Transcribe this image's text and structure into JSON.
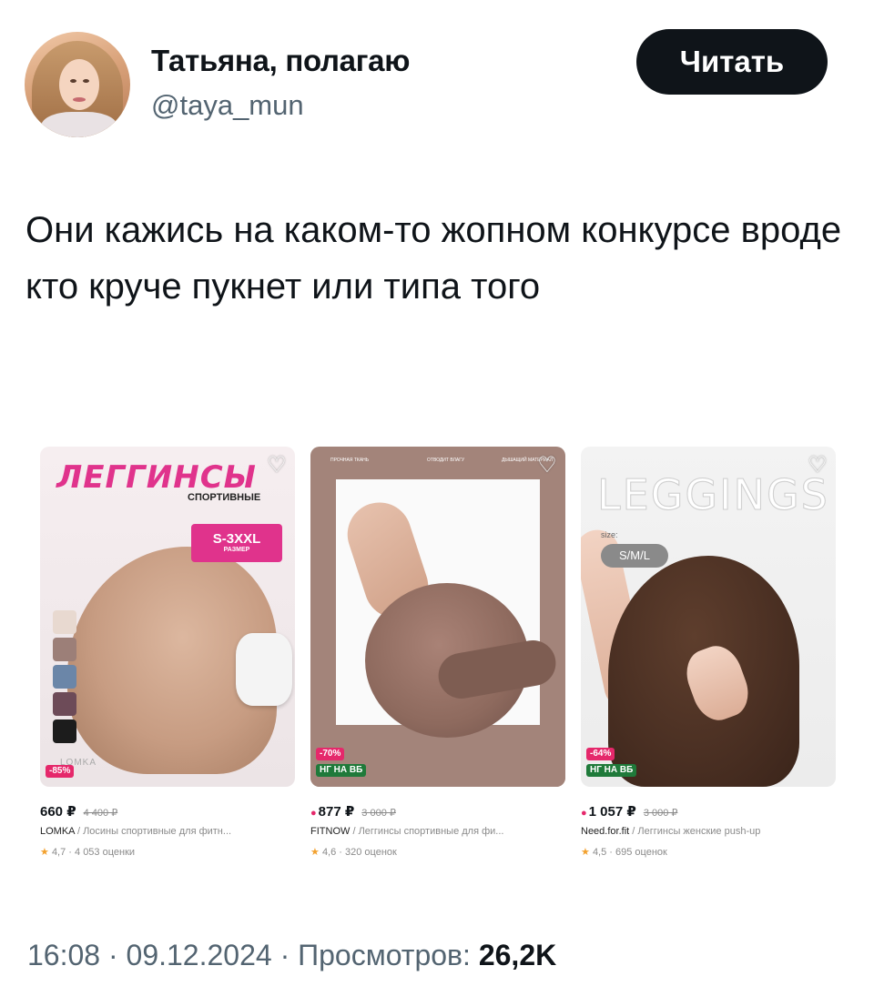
{
  "author": {
    "name": "Татьяна, полагаю",
    "handle": "@taya_mun",
    "avatar_icon": "profile-photo"
  },
  "follow_button_label": "Читать",
  "tweet_text": "Они кажись на каком-то жопном конкурсе вроде кто круче пукнет или типа того",
  "products": [
    {
      "image": {
        "title": "ЛЕГГИНСЫ",
        "subtitle": "СПОРТИВНЫЕ",
        "size": "S-3XXL",
        "size_caption": "РАЗМЕР",
        "logo": "LOMKA",
        "swatches": [
          "#e8d9d0",
          "#9c7f78",
          "#6b86a8",
          "#6d4b58",
          "#1c1c1c"
        ],
        "badge_sale": "-85%"
      },
      "price": "660 ₽",
      "old_price": "4 400 ₽",
      "brand": "LOMKA",
      "description": "Лосины спортивные для фитн...",
      "rating": "4,7",
      "reviews": "4 053 оценки"
    },
    {
      "image": {
        "top_labels": [
          "ПРОЧНАЯ ТКАНЬ",
          "ОТВОДИТ ВЛАГУ",
          "ДЫШАЩИЙ МАТЕРИАЛ"
        ],
        "badge_sale": "-70%",
        "badge_ng": "НГ НА ВБ"
      },
      "price": "877 ₽",
      "old_price": "3 000 ₽",
      "brand": "FITNOW",
      "description": "Леггинсы спортивные для фи...",
      "rating": "4,6",
      "reviews": "320 оценок"
    },
    {
      "image": {
        "word": "LEGGINGS",
        "size_label": "size:",
        "size": "S/M/L",
        "badge_sale": "-64%",
        "badge_ng": "НГ НА ВБ"
      },
      "price": "1 057 ₽",
      "old_price": "3 000 ₽",
      "brand": "Need.for.fit",
      "description": "Леггинсы женские push-up",
      "rating": "4,5",
      "reviews": "695 оценок"
    }
  ],
  "meta": {
    "time": "16:08",
    "date": "09.12.2024",
    "views_label": "Просмотров:",
    "views": "26,2K"
  },
  "colors": {
    "text": "#0f1419",
    "secondary": "#536471",
    "button_bg": "#0f1419",
    "sale_pink": "#e5286b",
    "ng_green": "#1f7a3a",
    "star": "#f3a12e"
  }
}
